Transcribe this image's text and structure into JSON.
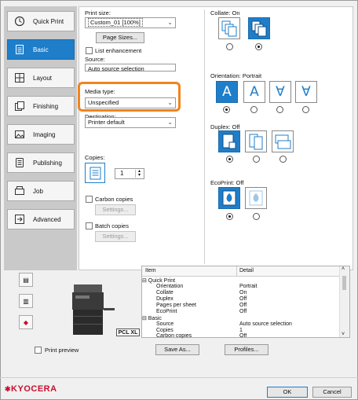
{
  "sidebar": {
    "items": [
      {
        "label": "Quick Print",
        "icon": "clock-icon"
      },
      {
        "label": "Basic",
        "icon": "basic-icon"
      },
      {
        "label": "Layout",
        "icon": "layout-icon"
      },
      {
        "label": "Finishing",
        "icon": "finishing-icon"
      },
      {
        "label": "Imaging",
        "icon": "imaging-icon"
      },
      {
        "label": "Publishing",
        "icon": "publishing-icon"
      },
      {
        "label": "Job",
        "icon": "job-icon"
      },
      {
        "label": "Advanced",
        "icon": "advanced-icon"
      }
    ],
    "active": "Basic"
  },
  "basic": {
    "print_size_label": "Print size:",
    "print_size_value": "Custom_01 [100%]",
    "page_sizes_button": "Page Sizes...",
    "list_enhancement": "List enhancement",
    "source_label": "Source:",
    "source_value": "Auto source selection",
    "media_type_label": "Media type:",
    "media_type_value": "Unspecified",
    "destination_label": "Destination:",
    "destination_value": "Printer default",
    "copies_label": "Copies:",
    "copies_value": "1",
    "carbon_copies": "Carbon copies",
    "settings_button_1": "Settings...",
    "batch_copies": "Batch copies",
    "settings_button_2": "Settings..."
  },
  "right": {
    "collate_label": "Collate:  On",
    "orientation_label": "Orientation:  Portrait",
    "duplex_label": "Duplex:  Off",
    "ecoprint_label": "EcoPrint:  Off",
    "orientation_glyphs": [
      "A",
      "A",
      "∀",
      "∀"
    ]
  },
  "summary": {
    "col_item": "Item",
    "col_detail": "Detail",
    "rows": [
      {
        "item": "⊟ Quick Print",
        "detail": ""
      },
      {
        "item": "Orientation",
        "detail": "Portrait"
      },
      {
        "item": "Collate",
        "detail": "On"
      },
      {
        "item": "Duplex",
        "detail": "Off"
      },
      {
        "item": "Pages per sheet",
        "detail": "Off"
      },
      {
        "item": "EcoPrint",
        "detail": "Off"
      },
      {
        "item": "⊟ Basic",
        "detail": ""
      },
      {
        "item": "Source",
        "detail": "Auto source selection"
      },
      {
        "item": "Copies",
        "detail": "1"
      },
      {
        "item": "Carbon copies",
        "detail": "Off"
      }
    ]
  },
  "preview": {
    "badge": "PCL XL",
    "print_preview": "Print preview"
  },
  "footer": {
    "save_as": "Save As...",
    "profiles": "Profiles...",
    "ok": "OK",
    "cancel": "Cancel",
    "logo": "KYOCERA"
  },
  "colors": {
    "accent": "#1f7ec9",
    "highlight": "#f0841e",
    "brand": "#c8102e"
  }
}
